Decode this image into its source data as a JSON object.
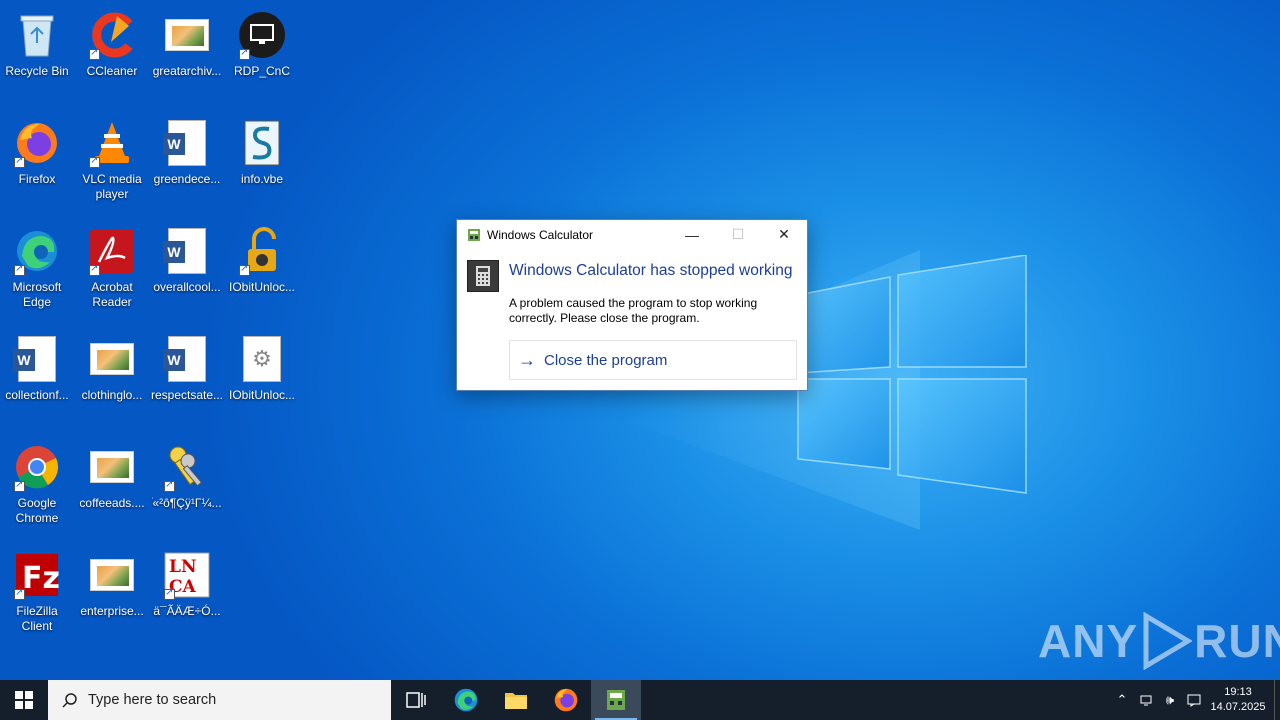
{
  "desktop": {
    "icons": [
      {
        "label": "Recycle Bin",
        "icon": "recycle-bin-icon"
      },
      {
        "label": "CCleaner",
        "icon": "ccleaner-icon"
      },
      {
        "label": "greatarchiv...",
        "icon": "image-file-icon"
      },
      {
        "label": "RDP_CnC",
        "icon": "rdp-icon"
      },
      {
        "label": "Firefox",
        "icon": "firefox-icon"
      },
      {
        "label": "VLC media player",
        "icon": "vlc-icon"
      },
      {
        "label": "greendece...",
        "icon": "word-doc-icon"
      },
      {
        "label": "info.vbe",
        "icon": "script-file-icon"
      },
      {
        "label": "Microsoft Edge",
        "icon": "edge-icon"
      },
      {
        "label": "Acrobat Reader",
        "icon": "acrobat-icon"
      },
      {
        "label": "overallcool...",
        "icon": "word-doc-icon"
      },
      {
        "label": "IObitUnloc...",
        "icon": "iobit-unlocker-icon"
      },
      {
        "label": "collectionf...",
        "icon": "word-doc-icon"
      },
      {
        "label": "clothinglo...",
        "icon": "image-file-icon"
      },
      {
        "label": "respectsate...",
        "icon": "word-doc-icon"
      },
      {
        "label": "IObitUnloc...",
        "icon": "settings-file-icon"
      },
      {
        "label": "Google Chrome",
        "icon": "chrome-icon"
      },
      {
        "label": "coffeeads....",
        "icon": "image-file-icon"
      },
      {
        "label": "ׂ«²ô¶Çÿ¹Γ¼...",
        "icon": "keys-icon"
      },
      {
        "label": "FileZilla Client",
        "icon": "filezilla-icon"
      },
      {
        "label": "enterprise...",
        "icon": "image-file-icon"
      },
      {
        "label": "ä¯ÃÄÆ÷Ó...",
        "icon": "lnca-icon"
      }
    ]
  },
  "dialog": {
    "title": "Windows Calculator",
    "heading": "Windows Calculator has stopped working",
    "description": "A problem caused the program to stop working correctly. Please close the program.",
    "command": "Close the program"
  },
  "watermark": {
    "left": "ANY",
    "right": "RUN"
  },
  "taskbar": {
    "search_placeholder": "Type here to search",
    "apps": [
      "task-view-icon",
      "edge-icon",
      "file-explorer-icon",
      "firefox-icon",
      "calculator-icon"
    ],
    "time": "19:13",
    "date": "14.07.2025"
  },
  "colors": {
    "accent": "#1c3f95",
    "taskbar": "#151f2b"
  }
}
